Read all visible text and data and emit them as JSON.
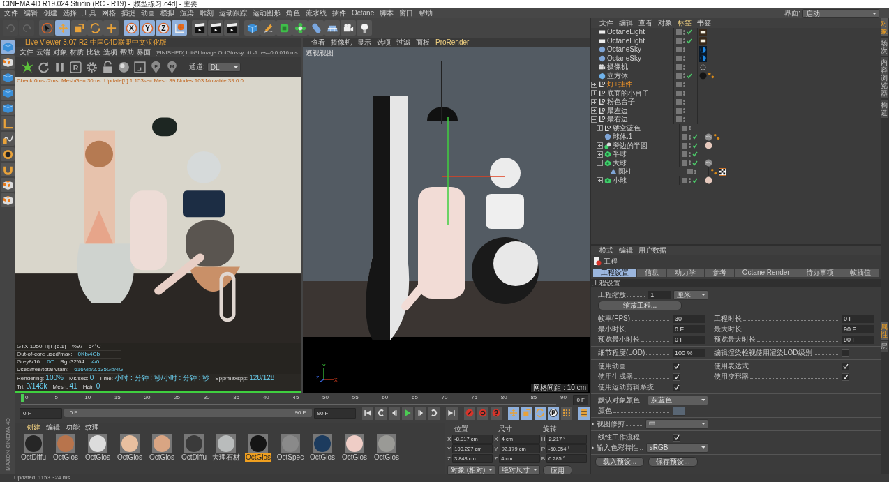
{
  "window": {
    "title": "CINEMA 4D R19.024 Studio (RC - R19) - [模型练习.c4d] - 主要"
  },
  "menu": [
    "文件",
    "编辑",
    "创建",
    "选择",
    "工具",
    "网格",
    "捕捉",
    "动画",
    "模拟",
    "渲染",
    "雕刻",
    "运动跟踪",
    "运动图形",
    "角色",
    "流水线",
    "插件",
    "Octane",
    "脚本",
    "窗口",
    "帮助"
  ],
  "layout_selector": {
    "label": "界面:",
    "value": "启动"
  },
  "toolbar": [
    {
      "kind": "undo",
      "disabled": true
    },
    {
      "kind": "redo",
      "disabled": true
    },
    {
      "kind": "cursor",
      "disabled": false,
      "selected": false
    },
    {
      "kind": "move",
      "disabled": false,
      "selected": true
    },
    {
      "kind": "scale",
      "disabled": false,
      "selected": false
    },
    {
      "kind": "rotate",
      "disabled": false,
      "selected": false
    },
    {
      "kind": "plus",
      "disabled": false,
      "selected": false
    },
    {
      "kind": "axis",
      "label": "X",
      "disabled": false,
      "selected": true
    },
    {
      "kind": "axis",
      "label": "Y",
      "disabled": false,
      "selected": true
    },
    {
      "kind": "axis",
      "label": "Z",
      "disabled": false,
      "selected": true
    },
    {
      "kind": "globe",
      "disabled": false,
      "selected": true
    },
    {
      "kind": "clapper",
      "disabled": false,
      "selected": false
    },
    {
      "kind": "clapper",
      "disabled": false,
      "selected": false
    },
    {
      "kind": "clapper",
      "disabled": false,
      "selected": false
    },
    {
      "kind": "cube",
      "disabled": false,
      "selected": false
    },
    {
      "kind": "pen",
      "disabled": false,
      "selected": false
    },
    {
      "kind": "green-cube",
      "disabled": false,
      "selected": false
    },
    {
      "kind": "flower",
      "disabled": false,
      "selected": false
    },
    {
      "kind": "capsule",
      "disabled": false,
      "selected": false
    },
    {
      "kind": "grid",
      "disabled": false,
      "selected": false
    },
    {
      "kind": "camera",
      "disabled": false,
      "selected": false
    },
    {
      "kind": "bulb",
      "disabled": false,
      "selected": false
    }
  ],
  "side_tools": [
    {
      "kind": "cube",
      "selected": true
    },
    {
      "kind": "checker",
      "selected": false
    },
    {
      "kind": "cube",
      "selected": false
    },
    {
      "kind": "cube",
      "selected": false
    },
    {
      "kind": "cube",
      "selected": false
    },
    {
      "kind": "angle",
      "selected": false
    },
    {
      "kind": "curve",
      "selected": false
    },
    {
      "kind": "snap",
      "selected": false
    },
    {
      "kind": "magnet",
      "selected": false
    },
    {
      "kind": "checker",
      "selected": false
    },
    {
      "kind": "checker",
      "selected": false
    }
  ],
  "live_viewer": {
    "title": "Live Viewer 3.07-R2 中国C4D联盟中文汉化版",
    "menu": [
      "文件",
      "云端",
      "对象",
      "材质",
      "比较",
      "选项",
      "帮助",
      "界面"
    ],
    "status": "[FINISHED] InitGLImage:OctGlossy  bit:-1 res=0  0.016 ms.",
    "tools": [
      {
        "kind": "octane"
      },
      {
        "kind": "refresh"
      },
      {
        "kind": "pause"
      },
      {
        "kind": "letter",
        "label": "R"
      },
      {
        "kind": "gear"
      },
      {
        "kind": "lock"
      },
      {
        "kind": "sphere"
      },
      {
        "kind": "region"
      },
      {
        "kind": "pin",
        "label": "F"
      },
      {
        "kind": "pin",
        "label": "M"
      }
    ],
    "channel": {
      "label": "通道:",
      "value": "DL"
    },
    "info": "Check:0ms./2ms. MeshGen:30ms. Update[L]:1.153sec Mesh:39 Nodes:103 Movable:39  0 0",
    "stats": [
      [
        {
          "text": "GTX 1050 Ti[T](6.1)",
          "accent": false
        },
        {
          "text": "%97",
          "accent": false
        },
        {
          "text": "64°C",
          "accent": false
        }
      ],
      [
        {
          "text": "Out-of-core used/max:",
          "accent": false
        },
        {
          "text": "0Kb/4Gb",
          "accent": true
        }
      ],
      [
        {
          "text": "Grey8/16: ",
          "accent": false
        },
        {
          "text": "0/0",
          "accent": true
        },
        {
          "text": "Rgb32/64: ",
          "accent": false
        },
        {
          "text": "4/0",
          "accent": true
        }
      ],
      [
        {
          "text": "Used/free/total vram: ",
          "accent": false
        },
        {
          "text": "616Mb/2.535Gb/4G",
          "accent": true
        }
      ]
    ],
    "rendering": [
      {
        "label": "Rendering: ",
        "value": "100%"
      },
      {
        "label": "Ms/sec: ",
        "value": "0"
      },
      {
        "label": "Time: ",
        "value": "小时 : 分钟 : 秒/小时 : 分钟 : 秒"
      },
      {
        "label": "Spp/maxspp: ",
        "value": "128/128"
      },
      {
        "label": "Tri: ",
        "value": "0/149k"
      },
      {
        "label": "Mesh: ",
        "value": "41"
      },
      {
        "label": "Hair: ",
        "value": "0"
      }
    ],
    "progress": {
      "level": 1
    }
  },
  "viewport": {
    "menu": [
      {
        "label": "查看",
        "selected": false
      },
      {
        "label": "摄像机",
        "selected": false
      },
      {
        "label": "显示",
        "selected": false
      },
      {
        "label": "选项",
        "selected": false
      },
      {
        "label": "过滤",
        "selected": false
      },
      {
        "label": "面板",
        "selected": false
      },
      {
        "label": "ProRender",
        "selected": true
      }
    ],
    "view_name": "透视视图",
    "axis_labels": [
      "Y",
      "Z",
      "X"
    ],
    "grid_spacing": "网格间距 : 10 cm"
  },
  "timeline": {
    "ticks": [
      "0",
      "5",
      "10",
      "15",
      "20",
      "25",
      "30",
      "35",
      "40",
      "45",
      "50",
      "55",
      "60",
      "65",
      "70",
      "75",
      "80",
      "85",
      "90"
    ],
    "playhead": {
      "level": 0
    },
    "current": "0 F",
    "start": "0 F",
    "range_start": "0 F",
    "range_end": "90 F",
    "range": {
      "level": 1
    },
    "end": "90 F",
    "transport": [
      {
        "kind": "first",
        "selected": false
      },
      {
        "kind": "loop-back",
        "selected": false
      },
      {
        "kind": "step-back",
        "selected": false
      },
      {
        "kind": "play",
        "selected": false
      },
      {
        "kind": "step-forward",
        "selected": false
      },
      {
        "kind": "loop-forward",
        "selected": false
      },
      {
        "kind": "last",
        "selected": false
      },
      {
        "kind": "record",
        "selected": false
      },
      {
        "kind": "record-auto",
        "selected": false
      },
      {
        "kind": "question",
        "selected": false
      },
      {
        "kind": "move",
        "selected": true
      },
      {
        "kind": "scale",
        "selected": true
      },
      {
        "kind": "rotate",
        "selected": true
      },
      {
        "kind": "param",
        "selected": true
      },
      {
        "kind": "dots",
        "selected": false
      },
      {
        "kind": "film",
        "selected": true
      }
    ]
  },
  "materials": {
    "menu": [
      {
        "label": "创建",
        "selected": true
      },
      {
        "label": "编辑",
        "selected": false
      },
      {
        "label": "功能",
        "selected": false
      },
      {
        "label": "纹理",
        "selected": false
      }
    ],
    "items": [
      {
        "name": "OctDiffu",
        "color": "#262626",
        "selected": false
      },
      {
        "name": "OctGlos",
        "color": "#b8744c",
        "selected": false
      },
      {
        "name": "OctGlos",
        "color": "#dcdcdc",
        "selected": false
      },
      {
        "name": "OctGlos",
        "color": "#e8bf9f",
        "selected": false
      },
      {
        "name": "OctGlos",
        "color": "#d9a583",
        "selected": false
      },
      {
        "name": "OctDiffu",
        "color": "#3a3a3a",
        "selected": false
      },
      {
        "name": "大理石材",
        "color": "#b9bcbc",
        "selected": false
      },
      {
        "name": "OctGlos",
        "color": "#151515",
        "selected": true
      },
      {
        "name": "OctSpec",
        "color": "#8a8a8a",
        "selected": false
      },
      {
        "name": "OctGlos",
        "color": "#1c3b5e",
        "selected": false
      },
      {
        "name": "OctGlos",
        "color": "#efcdc6",
        "selected": false
      },
      {
        "name": "OctGlos",
        "color": "#9a9a96",
        "selected": false
      }
    ]
  },
  "coordinates": {
    "headers": [
      "位置",
      "尺寸",
      "旋转"
    ],
    "rows": [
      [
        {
          "axis": "X",
          "value": "-8.917 cm"
        },
        {
          "axis": "X",
          "value": "4 cm"
        },
        {
          "axis": "H",
          "value": "2.217 °"
        }
      ],
      [
        {
          "axis": "Y",
          "value": "100.227 cm"
        },
        {
          "axis": "Y",
          "value": "92.179 cm"
        },
        {
          "axis": "P",
          "value": "-50.054 °"
        }
      ],
      [
        {
          "axis": "Z",
          "value": "3.848 cm"
        },
        {
          "axis": "Z",
          "value": "4 cm"
        },
        {
          "axis": "B",
          "value": "6.285 °"
        }
      ]
    ],
    "modes": [
      "对象 (相对)",
      "绝对尺寸"
    ],
    "apply": "应用"
  },
  "logo": "MAXON CINEMA 4D",
  "status_bar": "Updated: 1153.324 ms.",
  "object_manager": {
    "menu": [
      {
        "label": "文件",
        "selected": false
      },
      {
        "label": "编辑",
        "selected": false
      },
      {
        "label": "查看",
        "selected": false
      },
      {
        "label": "对象",
        "selected": false
      },
      {
        "label": "标签",
        "selected": true
      },
      {
        "label": "书签",
        "selected": false
      }
    ],
    "objects": [
      {
        "name": "OctaneLight",
        "kind": "panel",
        "selected": false,
        "checked": true,
        "tags": [
          {
            "kind": "light-tag"
          }
        ]
      },
      {
        "name": "OctaneLight",
        "kind": "panel",
        "selected": false,
        "checked": true,
        "tags": [
          {
            "kind": "light-tag"
          }
        ]
      },
      {
        "name": "OctaneSky",
        "kind": "sphere",
        "selected": false,
        "checked": false,
        "tags": [
          {
            "kind": "sky-tag"
          }
        ]
      },
      {
        "name": "OctaneSky",
        "kind": "sphere",
        "selected": false,
        "checked": false,
        "tags": [
          {
            "kind": "sky-tag"
          }
        ]
      },
      {
        "name": "摄像机",
        "kind": "camera",
        "selected": false,
        "checked": false,
        "tags": [
          {
            "kind": "target-tag"
          }
        ]
      },
      {
        "name": "立方体",
        "kind": "cube",
        "selected": false,
        "checked": true,
        "tags": [
          {
            "kind": "black-ball"
          },
          {
            "kind": "dots"
          }
        ]
      },
      {
        "name": "灯+挂件",
        "kind": "null",
        "selected": true,
        "checked": false,
        "expanded": false
      },
      {
        "name": "底面的小台子",
        "kind": "null",
        "selected": false,
        "checked": false,
        "expanded": false
      },
      {
        "name": "粉色台子",
        "kind": "null",
        "selected": false,
        "checked": false,
        "expanded": false
      },
      {
        "name": "最左边",
        "kind": "null",
        "selected": false,
        "checked": false,
        "expanded": false
      },
      {
        "name": "最右边",
        "kind": "null",
        "selected": false,
        "checked": false,
        "expanded": true,
        "children": [
          {
            "name": "镂空蓝色",
            "kind": "null",
            "selected": false,
            "checked": false,
            "expanded": false
          },
          {
            "name": "球体.1",
            "kind": "sphere",
            "selected": false,
            "checked": true,
            "tags": [
              {
                "kind": "marble-ball"
              },
              {
                "kind": "dots"
              }
            ]
          },
          {
            "name": "旁边的半圆",
            "kind": "boolean",
            "selected": false,
            "checked": true,
            "expanded": false,
            "tags": [
              {
                "kind": "pink-ball"
              }
            ]
          },
          {
            "name": "半球",
            "kind": "generator",
            "selected": false,
            "checked": true,
            "expanded": false
          },
          {
            "name": "大球",
            "kind": "generator",
            "selected": false,
            "checked": true,
            "expanded": true,
            "tags": [
              {
                "kind": "marble-ball"
              }
            ],
            "children": [
              {
                "name": "圆柱",
                "kind": "deformer",
                "selected": false,
                "checked": false,
                "tags": [
                  {
                    "kind": "dots"
                  },
                  {
                    "kind": "checker"
                  }
                ]
              }
            ]
          },
          {
            "name": "小球",
            "kind": "generator",
            "selected": false,
            "checked": true,
            "expanded": false,
            "tags": [
              {
                "kind": "pink-ball"
              }
            ]
          }
        ]
      }
    ]
  },
  "side_tabs_top": [
    {
      "label": "对象",
      "selected": true
    },
    {
      "label": "场次",
      "selected": false
    },
    {
      "label": "内容浏览器",
      "selected": false
    },
    {
      "label": "构造",
      "selected": false
    }
  ],
  "side_tabs_bottom": [
    {
      "label": "属性",
      "selected": true
    },
    {
      "label": "层",
      "selected": false
    }
  ],
  "attributes": {
    "menu": [
      "模式",
      "编辑",
      "用户数据"
    ],
    "header": "工程",
    "tabs": [
      {
        "label": "工程设置",
        "selected": true
      },
      {
        "label": "信息",
        "selected": false
      },
      {
        "label": "动力学",
        "selected": false
      },
      {
        "label": "参考",
        "selected": false
      },
      {
        "label": "Octane Render",
        "selected": false
      },
      {
        "label": "待办事项",
        "selected": false
      },
      {
        "label": "帧插值",
        "selected": false
      }
    ],
    "section": "工程设置",
    "groups": [
      [
        [
          {
            "kind": "number",
            "label": "工程缩放",
            "value": "1",
            "unit": "厘米"
          }
        ],
        [
          {
            "kind": "button",
            "label": "缩放工程..."
          }
        ]
      ],
      [
        [
          {
            "kind": "number",
            "label": "帧率(FPS)",
            "value": "30"
          },
          {
            "kind": "number",
            "label": "工程时长",
            "value": "0 F"
          }
        ],
        [
          {
            "kind": "number",
            "label": "最小时长",
            "value": "0 F"
          },
          {
            "kind": "number",
            "label": "最大时长",
            "value": "90 F"
          }
        ],
        [
          {
            "kind": "number",
            "label": "预览最小时长",
            "value": "0 F"
          },
          {
            "kind": "number",
            "label": "预览最大时长",
            "value": "90 F"
          }
        ]
      ],
      [
        [
          {
            "kind": "number",
            "label": "细节程度(LOD)",
            "value": "100 %"
          },
          {
            "kind": "check",
            "label": "编辑渲染检视使用渲染LOD级别",
            "checked": false
          }
        ]
      ],
      [
        [
          {
            "kind": "check",
            "label": "使用动画",
            "checked": true
          },
          {
            "kind": "check",
            "label": "使用表达式",
            "checked": true
          }
        ],
        [
          {
            "kind": "check",
            "label": "使用生成器",
            "checked": true
          },
          {
            "kind": "check",
            "label": "使用变形器",
            "checked": true
          }
        ],
        [
          {
            "kind": "check",
            "label": "使用运动剪辑系统",
            "checked": true
          }
        ]
      ],
      [
        [
          {
            "kind": "dropdown",
            "label": "默认对象颜色",
            "value": "灰蓝色"
          }
        ],
        [
          {
            "kind": "color",
            "label": "颜色",
            "color": "#596674"
          }
        ]
      ],
      [
        [
          {
            "kind": "dropdown",
            "label": "视图修剪",
            "value": "中",
            "expanded": false
          }
        ]
      ],
      [
        [
          {
            "kind": "check",
            "label": "线性工作流程",
            "checked": true
          }
        ],
        [
          {
            "kind": "dropdown",
            "label": "输入色彩特性",
            "value": "sRGB",
            "expanded": false
          }
        ]
      ]
    ],
    "presets": [
      "载入预设...",
      "保存预设..."
    ]
  }
}
